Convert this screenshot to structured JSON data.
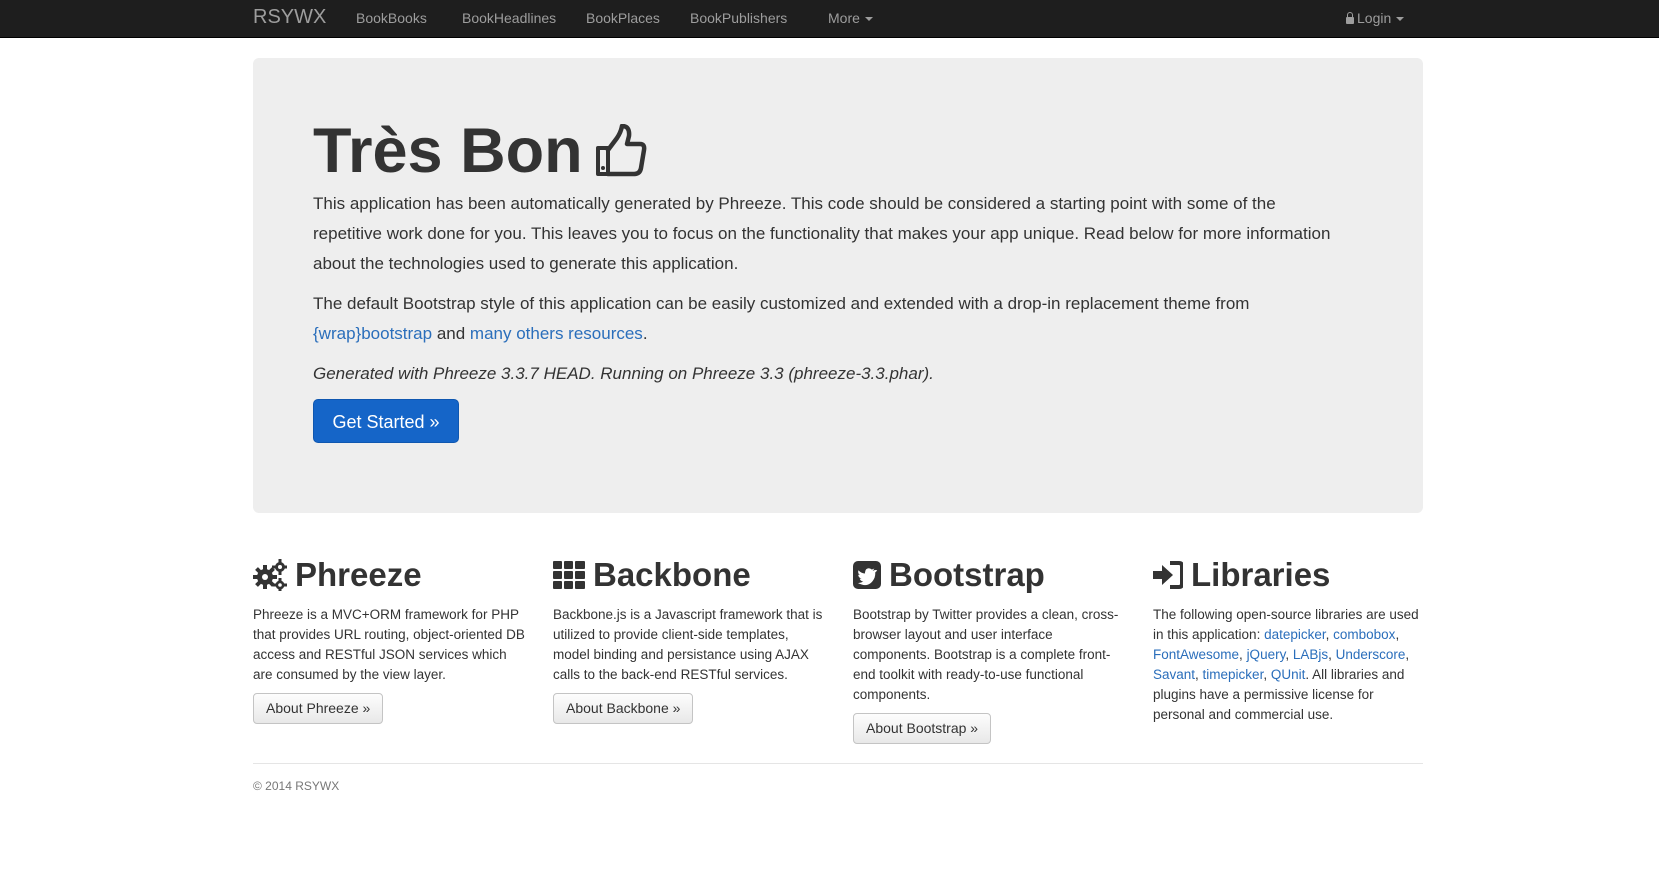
{
  "navbar": {
    "brand": "RSYWX",
    "items": [
      "BookBooks",
      "BookHeadlines",
      "BookPlaces",
      "BookPublishers"
    ],
    "more_label": "More",
    "login_label": "Login"
  },
  "jumbotron": {
    "title": "Très Bon",
    "paragraph1": "This application has been automatically generated by Phreeze. This code should be considered a starting point with some of the repetitive work done for you. This leaves you to focus on the functionality that makes your app unique. Read below for more information about the technologies used to generate this application.",
    "paragraph2_before": "The default Bootstrap style of this application can be easily customized and extended with a drop-in replacement theme from ",
    "paragraph2_link1": "{wrap}bootstrap",
    "paragraph2_mid": " and ",
    "paragraph2_link2": "many others resources",
    "paragraph2_after": ".",
    "generated_note": "Generated with Phreeze 3.3.7 HEAD. Running on Phreeze 3.3 (phreeze-3.3.phar).",
    "button_label": "Get Started »"
  },
  "columns": {
    "phreeze": {
      "title": "Phreeze",
      "text": "Phreeze is a MVC+ORM framework for PHP that provides URL routing, object-oriented DB access and RESTful JSON services which are consumed by the view layer.",
      "button_label": "About Phreeze »"
    },
    "backbone": {
      "title": "Backbone",
      "text": "Backbone.js is a Javascript framework that is utilized to provide client-side templates, model binding and persistance using AJAX calls to the back-end RESTful services.",
      "button_label": "About Backbone »"
    },
    "bootstrap": {
      "title": "Bootstrap",
      "text": "Bootstrap by Twitter provides a clean, cross-browser layout and user interface components. Bootstrap is a complete front-end toolkit with ready-to-use functional components.",
      "button_label": "About Bootstrap »"
    },
    "libraries": {
      "title": "Libraries",
      "text_before": "The following open-source libraries are used in this application: ",
      "links": [
        "datepicker",
        "combobox",
        "FontAwesome",
        "jQuery",
        "LABjs",
        "Underscore",
        "Savant",
        "timepicker",
        "QUnit"
      ],
      "separator": ", ",
      "text_after": ". All libraries and plugins have a permissive license for personal and commercial use."
    }
  },
  "footer": {
    "copyright": "© 2014 RSYWX"
  },
  "icons": {
    "lock": "lock-icon",
    "caret": "caret-down-icon",
    "thumb": "thumbs-up-icon",
    "phreeze": "cogs-icon",
    "backbone": "th-grid-icon",
    "bootstrap": "twitter-square-icon",
    "libraries": "sign-in-icon"
  },
  "colors": {
    "navbar_bg": "#1e1e1e",
    "jumbotron_bg": "#eeeeee",
    "primary_button": "#1565c8",
    "link": "#2a6ebb"
  }
}
